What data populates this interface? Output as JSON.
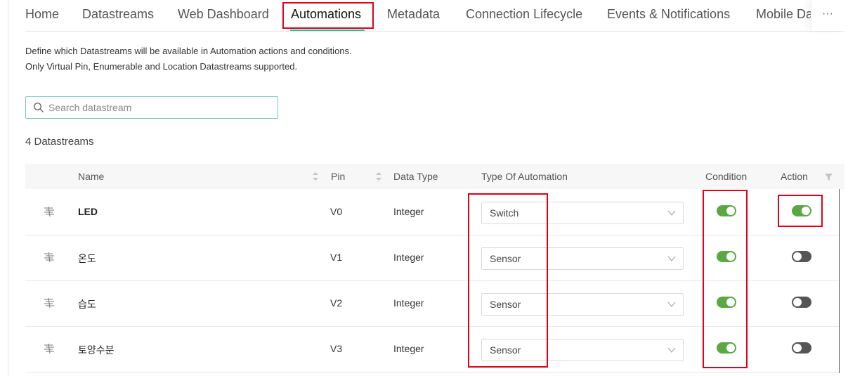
{
  "tabs": [
    {
      "label": "Home",
      "active": false
    },
    {
      "label": "Datastreams",
      "active": false
    },
    {
      "label": "Web Dashboard",
      "active": false
    },
    {
      "label": "Automations",
      "active": true
    },
    {
      "label": "Metadata",
      "active": false
    },
    {
      "label": "Connection Lifecycle",
      "active": false
    },
    {
      "label": "Events & Notifications",
      "active": false
    },
    {
      "label": "Mobile Da",
      "active": false
    }
  ],
  "more_label": "···",
  "description": {
    "line1": "Define which Datastreams will be available in Automation actions and conditions.",
    "line2": "Only Virtual Pin, Enumerable and Location Datastreams supported."
  },
  "search": {
    "placeholder": "Search datastream",
    "value": ""
  },
  "count_label": "4 Datastreams",
  "columns": {
    "name": "Name",
    "pin": "Pin",
    "data_type": "Data Type",
    "type_of_automation": "Type Of Automation",
    "condition": "Condition",
    "action": "Action"
  },
  "rows": [
    {
      "name": "LED",
      "pin": "V0",
      "data_type": "Integer",
      "automation_type": "Switch",
      "condition": true,
      "action": true
    },
    {
      "name": "온도",
      "pin": "V1",
      "data_type": "Integer",
      "automation_type": "Sensor",
      "condition": true,
      "action": false
    },
    {
      "name": "습도",
      "pin": "V2",
      "data_type": "Integer",
      "automation_type": "Sensor",
      "condition": true,
      "action": false
    },
    {
      "name": "토양수분",
      "pin": "V3",
      "data_type": "Integer",
      "automation_type": "Sensor",
      "condition": true,
      "action": false
    }
  ],
  "colors": {
    "accent_underline": "#23c48e",
    "toggle_on": "#5aa843",
    "toggle_off": "#555555",
    "highlight": "#e0001a"
  }
}
